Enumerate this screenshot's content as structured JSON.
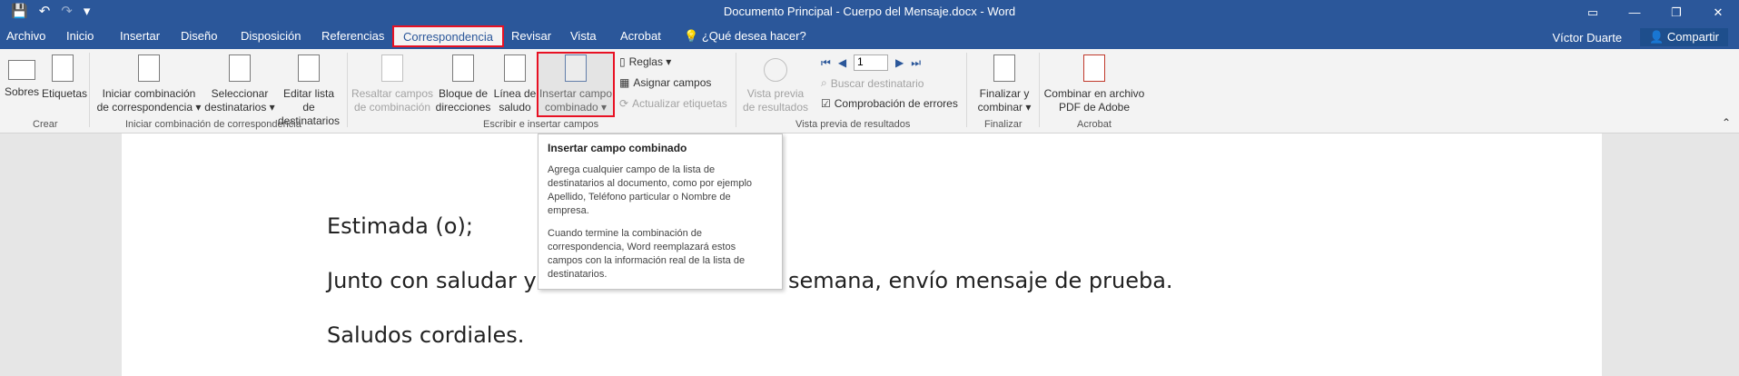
{
  "titlebar": {
    "title": "Documento Principal - Cuerpo del Mensaje.docx - Word",
    "qat": {
      "save_icon": "💾",
      "undo_icon": "↶",
      "redo_icon": "↷",
      "customize_icon": "▾"
    },
    "controls": {
      "ribbon_display": "▭",
      "minimize": "—",
      "restore": "❐",
      "close": "✕"
    }
  },
  "tabs": [
    {
      "label": "Archivo"
    },
    {
      "label": "Inicio"
    },
    {
      "label": "Insertar"
    },
    {
      "label": "Diseño"
    },
    {
      "label": "Disposición"
    },
    {
      "label": "Referencias"
    },
    {
      "label": "Correspondencia"
    },
    {
      "label": "Revisar"
    },
    {
      "label": "Vista"
    },
    {
      "label": "Acrobat"
    }
  ],
  "tellme": "¿Qué desea hacer?",
  "user": "Víctor Duarte",
  "share": "Compartir",
  "ribbon": {
    "crear": {
      "sobres": "Sobres",
      "etiquetas": "Etiquetas",
      "group": "Crear"
    },
    "iniciar": {
      "b1_l1": "Iniciar combinación",
      "b1_l2": "de correspondencia ▾",
      "b2_l1": "Seleccionar",
      "b2_l2": "destinatarios ▾",
      "b3_l1": "Editar lista de",
      "b3_l2": "destinatarios",
      "group": "Iniciar combinación de correspondencia"
    },
    "escribir": {
      "resaltar_l1": "Resaltar campos",
      "resaltar_l2": "de combinación",
      "bloque_l1": "Bloque de",
      "bloque_l2": "direcciones",
      "linea_l1": "Línea de",
      "linea_l2": "saludo",
      "insertar_l1": "Insertar campo",
      "insertar_l2": "combinado ▾",
      "reglas": "Reglas ▾",
      "asignar": "Asignar campos",
      "actualizar": "Actualizar etiquetas",
      "group": "Escribir e insertar campos"
    },
    "vista": {
      "vista_l1": "Vista previa",
      "vista_l2": "de resultados",
      "record": "1",
      "buscar": "Buscar destinatario",
      "comprobacion": "Comprobación de errores",
      "group": "Vista previa de resultados"
    },
    "finalizar": {
      "l1": "Finalizar y",
      "l2": "combinar ▾",
      "group": "Finalizar"
    },
    "acrobat": {
      "l1": "Combinar en archivo",
      "l2": "PDF de Adobe",
      "group": "Acrobat"
    }
  },
  "document": {
    "p1": "Estimada (o);",
    "p2a": "Junto con saludar y",
    "p2b": "semana, envío mensaje de prueba.",
    "p3": "Saludos cordiales."
  },
  "tooltip": {
    "title": "Insertar campo combinado",
    "p1": "Agrega cualquier campo de la lista de destinatarios al documento, como por ejemplo Apellido, Teléfono particular o Nombre de empresa.",
    "p2": "Cuando termine la combinación de correspondencia, Word reemplazará estos campos con la información real de la lista de destinatarios."
  }
}
